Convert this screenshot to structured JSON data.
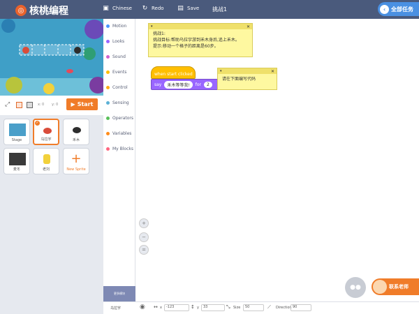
{
  "topbar": {
    "brand": "核桃编程",
    "language": "Chinese",
    "redo": "Redo",
    "save": "Save",
    "project_title": "挑战1",
    "all_tasks": "全部任务"
  },
  "stagebar": {
    "x_label": "x:",
    "x_value": "0",
    "y_label": "y:",
    "y_value": "0",
    "start": "Start"
  },
  "sprites": {
    "stage": "Stage",
    "items": [
      "乌拉宇",
      "禾木",
      "麦冬",
      "老刘",
      "New Sprite"
    ]
  },
  "categories": [
    {
      "label": "Motion",
      "color": "#4c97ff"
    },
    {
      "label": "Looks",
      "color": "#9966ff"
    },
    {
      "label": "Sound",
      "color": "#cf63cf"
    },
    {
      "label": "Events",
      "color": "#ffbf00"
    },
    {
      "label": "Control",
      "color": "#ffab19"
    },
    {
      "label": "Sensing",
      "color": "#5cb1d6"
    },
    {
      "label": "Operators",
      "color": "#59c059"
    },
    {
      "label": "Variables",
      "color": "#ff8c1a"
    },
    {
      "label": "My Blocks",
      "color": "#ff6680"
    }
  ],
  "more_blocks": "更多模块",
  "workspace": {
    "note1": {
      "line1": "挑战1:",
      "line2": "挑战目标:帮助乌拉宇游到禾木身后,追上禾木。",
      "line3": "提示:移动一个格子的距离是60步。"
    },
    "note2": "请在下面编写代码",
    "hat_block": "when start clicked",
    "say_label": "say",
    "say_text": "禾木等等我!",
    "for_label": "for",
    "for_value": "2"
  },
  "contact": "联系老师",
  "bottom": {
    "sprite_name": "乌拉宇",
    "x_label": "x",
    "x_value": "-123",
    "y_label": "y",
    "y_value": "33",
    "size_label": "Size",
    "size_value": "50",
    "direction_label": "Direction",
    "direction_value": "90"
  }
}
